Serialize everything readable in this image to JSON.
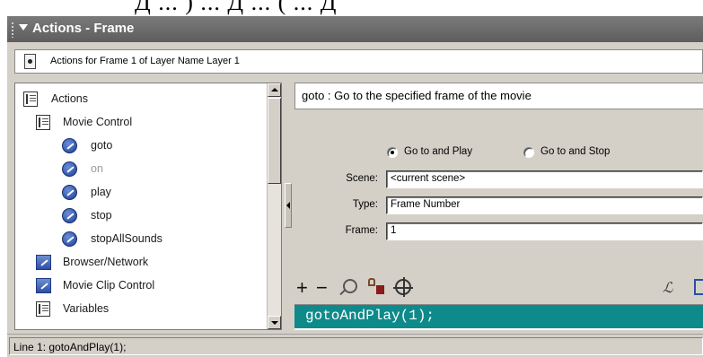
{
  "cropped_header_text": "Д ... ) ... Д ... ( ... Д",
  "panel": {
    "title": "Actions - Frame",
    "context_label": "Actions for Frame 1 of Layer Name Layer 1"
  },
  "toolbox": {
    "items": [
      {
        "label": "Actions",
        "icon": "book-icon"
      },
      {
        "label": "Movie Control",
        "icon": "book-icon"
      },
      {
        "label": "goto",
        "icon": "action-icon"
      },
      {
        "label": "on",
        "icon": "action-icon",
        "disabled": true
      },
      {
        "label": "play",
        "icon": "action-icon"
      },
      {
        "label": "stop",
        "icon": "action-icon"
      },
      {
        "label": "stopAllSounds",
        "icon": "action-icon"
      },
      {
        "label": "Browser/Network",
        "icon": "category-icon"
      },
      {
        "label": "Movie Clip Control",
        "icon": "category-icon"
      },
      {
        "label": "Variables",
        "icon": "book-icon"
      }
    ]
  },
  "description": "goto : Go to the specified frame of the movie",
  "parameters": {
    "radio_play": "Go to and Play",
    "radio_stop": "Go to and Stop",
    "selected": "play",
    "scene_label": "Scene:",
    "scene_value": "<current scene>",
    "type_label": "Type:",
    "type_value": "Frame Number",
    "frame_label": "Frame:",
    "frame_value": "1"
  },
  "toolbar": {
    "add": "+",
    "remove": "−",
    "icons": [
      "find-icon",
      "insert-target-path-icon",
      "crosshair-icon",
      "reference-icon"
    ]
  },
  "code": {
    "line1": "gotoAndPlay(1);"
  },
  "status": "Line 1: gotoAndPlay(1);",
  "colors": {
    "title_bar": "#6a6a6a",
    "code_highlight": "#0f8a8a",
    "chrome": "#d4d0c8"
  }
}
